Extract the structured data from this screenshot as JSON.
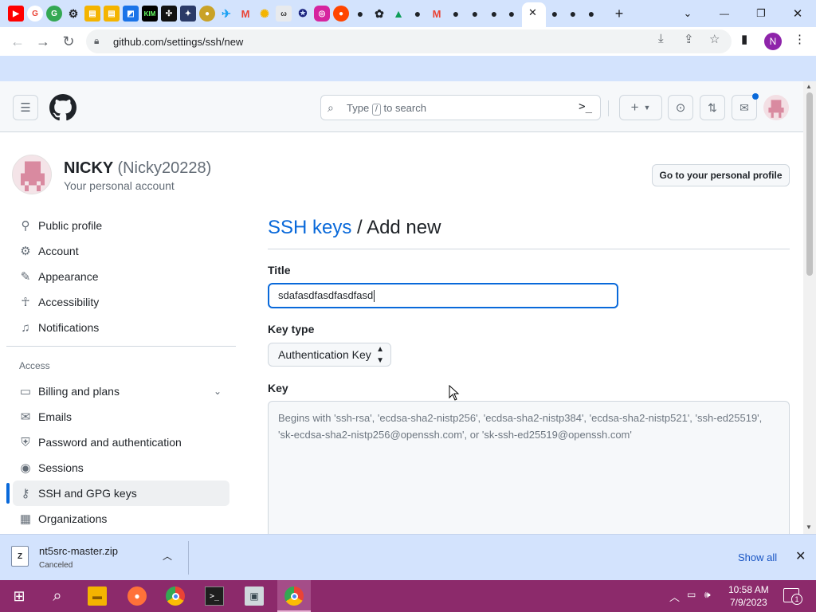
{
  "browser": {
    "url": "github.com/settings/ssh/new",
    "new_tab": "+",
    "min": "—",
    "restore": "❐",
    "close": "✕",
    "profile_initial": "N"
  },
  "header": {
    "search_placeholder_before": "Type",
    "search_slash": "/",
    "search_placeholder_after": "to search",
    "command_palette": ">_"
  },
  "profile": {
    "display_name": "NICKY",
    "login": "(Nicky20228)",
    "subtitle": "Your personal account",
    "go_to_profile": "Go to your personal profile"
  },
  "sidebar": {
    "top_items": [
      {
        "label": "Public profile",
        "icon": "person-icon"
      },
      {
        "label": "Account",
        "icon": "gear-icon"
      },
      {
        "label": "Appearance",
        "icon": "paintbrush-icon"
      },
      {
        "label": "Accessibility",
        "icon": "accessibility-icon"
      },
      {
        "label": "Notifications",
        "icon": "bell-icon"
      }
    ],
    "access_heading": "Access",
    "access_items": [
      {
        "label": "Billing and plans",
        "icon": "credit-card-icon"
      },
      {
        "label": "Emails",
        "icon": "mail-icon"
      },
      {
        "label": "Password and authentication",
        "icon": "shield-lock-icon"
      },
      {
        "label": "Sessions",
        "icon": "broadcast-icon"
      },
      {
        "label": "SSH and GPG keys",
        "icon": "key-icon"
      },
      {
        "label": "Organizations",
        "icon": "table-icon"
      }
    ]
  },
  "main": {
    "breadcrumb_link": "SSH keys",
    "breadcrumb_sep": " / ",
    "breadcrumb_current": "Add new",
    "title_label": "Title",
    "title_value": "sdafasdfasdfasdfasd",
    "key_type_label": "Key type",
    "key_type_value": "Authentication Key",
    "key_label": "Key",
    "key_placeholder": "Begins with 'ssh-rsa', 'ecdsa-sha2-nistp256', 'ecdsa-sha2-nistp384', 'ecdsa-sha2-nistp521', 'ssh-ed25519', 'sk-ecdsa-sha2-nistp256@openssh.com', or 'sk-ssh-ed25519@openssh.com'"
  },
  "download": {
    "icon_text": "Z",
    "filename": "nt5src-master.zip",
    "status": "Canceled",
    "show_all": "Show all"
  },
  "taskbar": {
    "time": "10:58 AM",
    "date": "7/9/2023",
    "notifications": "1"
  },
  "colors": {
    "accent": "#0969da",
    "taskbar": "#8c2a6b",
    "chrome_frame": "#d3e3fd"
  }
}
